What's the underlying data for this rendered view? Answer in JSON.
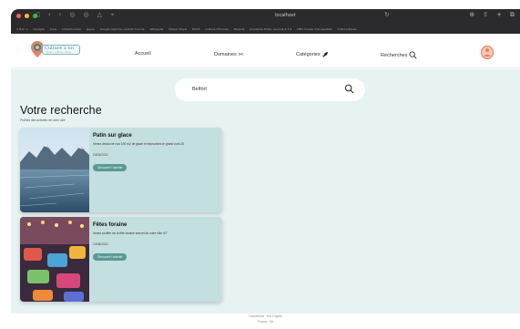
{
  "browser": {
    "address": "localhost",
    "favorites": [
      "4 Hub' s",
      "Voyages",
      "Livre",
      "Infrastructure",
      "Jaquie",
      "Google Captcha, contrat Yvonne",
      "Wikipedia",
      "Maison Royal",
      "DAOS",
      "Culture d'Europe",
      "Neupris",
      "Academie Hotel, Leonnie 4 3 2",
      "HED Course d'accessibite",
      "Culture Basse"
    ]
  },
  "header": {
    "logo_text": "Culture à toi",
    "logo_sub": "sport / culture / loisirs",
    "nav": {
      "accueil": "Accueil",
      "domaines": "Domaines",
      "categories": "Catégories",
      "recherches": "Recherches"
    }
  },
  "search": {
    "value": "Belfort"
  },
  "page": {
    "title": "Votre recherche",
    "subtitle": "Profitez des activités de votre ville"
  },
  "results": [
    {
      "title": "Patin sur glace",
      "description": "Venez découvrir nos 190 m2 de glace et improvisez le grand com-20",
      "date": "24/04/2022",
      "button": "Découvrir l'activité"
    },
    {
      "title": "Fêtes foraine",
      "description": "Venez profiter de la fête foraine annuel de votre ville 4/7",
      "date": "14/06/2022",
      "button": "Découvrir l'activité"
    }
  ],
  "footer": {
    "line1": "Connexions · Sur 2 lignes",
    "line2": "Propos · Mt"
  },
  "colors": {
    "background": "#e7f2f3",
    "card": "#c4dfe0",
    "button": "#5a9994",
    "accent_user": "#e9806a"
  }
}
